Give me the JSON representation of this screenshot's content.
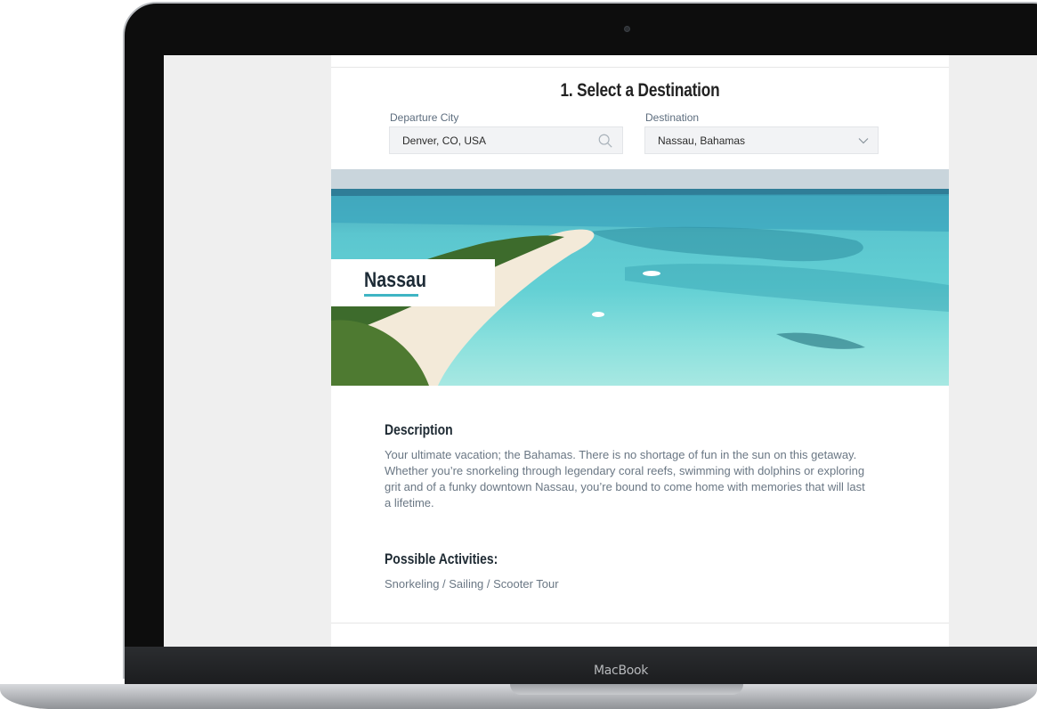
{
  "device": {
    "brand": "MacBook"
  },
  "section": {
    "title": "1. Select a Destination"
  },
  "form": {
    "departure": {
      "label": "Departure City",
      "value": "Denver, CO, USA"
    },
    "destination": {
      "label": "Destination",
      "value": "Nassau, Bahamas"
    }
  },
  "hero": {
    "title": "Nassau"
  },
  "description": {
    "heading": "Description",
    "lines": [
      "Your ultimate vacation; the Bahamas. There is no shortage of fun in the sun on this getaway.",
      "Whether you’re snorkeling through legendary coral reefs, swimming with dolphins or exploring",
      "grit and of a funky downtown Nassau, you’re bound to come home with memories that will last",
      "a lifetime."
    ]
  },
  "activities": {
    "heading": "Possible Activities:",
    "text": "Snorkeling / Sailing / Scooter Tour"
  },
  "colors": {
    "accent": "#3fb5c4",
    "field_bg": "#f2f3f5"
  },
  "icons": {
    "departure": "search-icon",
    "destination": "chevron-down-icon"
  }
}
